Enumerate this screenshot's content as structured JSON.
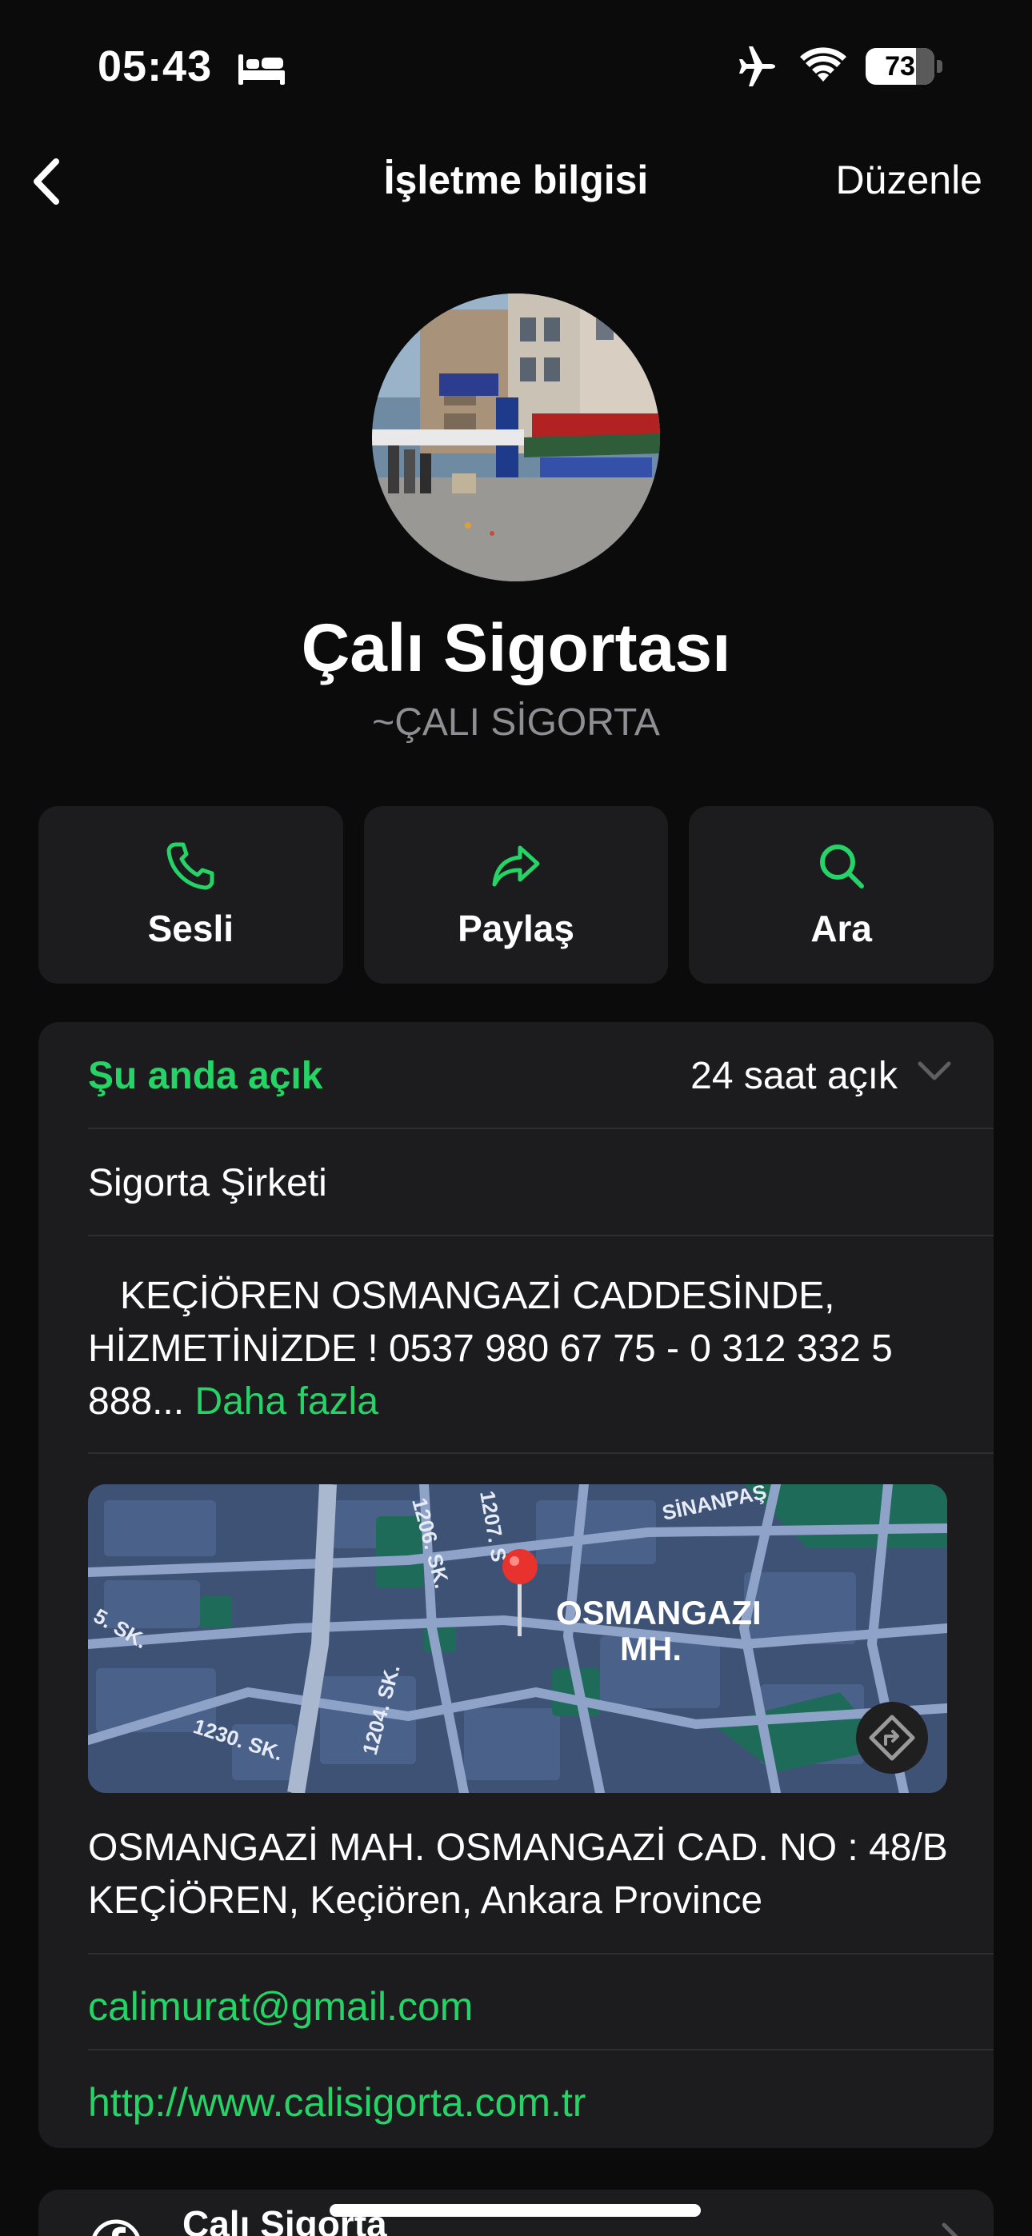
{
  "status_bar": {
    "time": "05:43",
    "battery": "73",
    "battery_level": 0.73
  },
  "nav": {
    "title": "İşletme bilgisi",
    "edit_label": "Düzenle"
  },
  "profile": {
    "name": "Çalı Sigortası",
    "alias": "~ÇALI SİGORTA"
  },
  "actions": [
    {
      "label": "Sesli",
      "icon": "phone-icon"
    },
    {
      "label": "Paylaş",
      "icon": "share-icon"
    },
    {
      "label": "Ara",
      "icon": "search-icon"
    }
  ],
  "info": {
    "open_status": "Şu anda açık",
    "hours": "24 saat açık",
    "category": "Sigorta Şirketi",
    "description": "   KEÇİÖREN OSMANGAZİ CADDESİNDE, HİZMETİNİZDE ! 0537 980 67 75 - 0 312 332 5 888...",
    "more_label": "Daha fazla",
    "address": "OSMANGAZİ MAH. OSMANGAZİ CAD. NO : 48/B KEÇİÖREN, Keçiören, Ankara Province",
    "email": "calimurat@gmail.com",
    "website": "http://www.calisigorta.com.tr"
  },
  "map": {
    "area_label_1": "OSMANGAZI",
    "area_label_2": "MH.",
    "street_1": "1206. SK.",
    "street_2": "1207. S",
    "street_3": "SİNANPAŞ",
    "street_4": "5. SK.",
    "street_5": "1230. SK.",
    "street_6": "1204. SK."
  },
  "social": {
    "label": "Çalı Sigorta"
  },
  "colors": {
    "accent": "#25d366",
    "background": "#0b0b0b",
    "card": "#1c1c1e",
    "secondary_text": "#8e8e93"
  }
}
